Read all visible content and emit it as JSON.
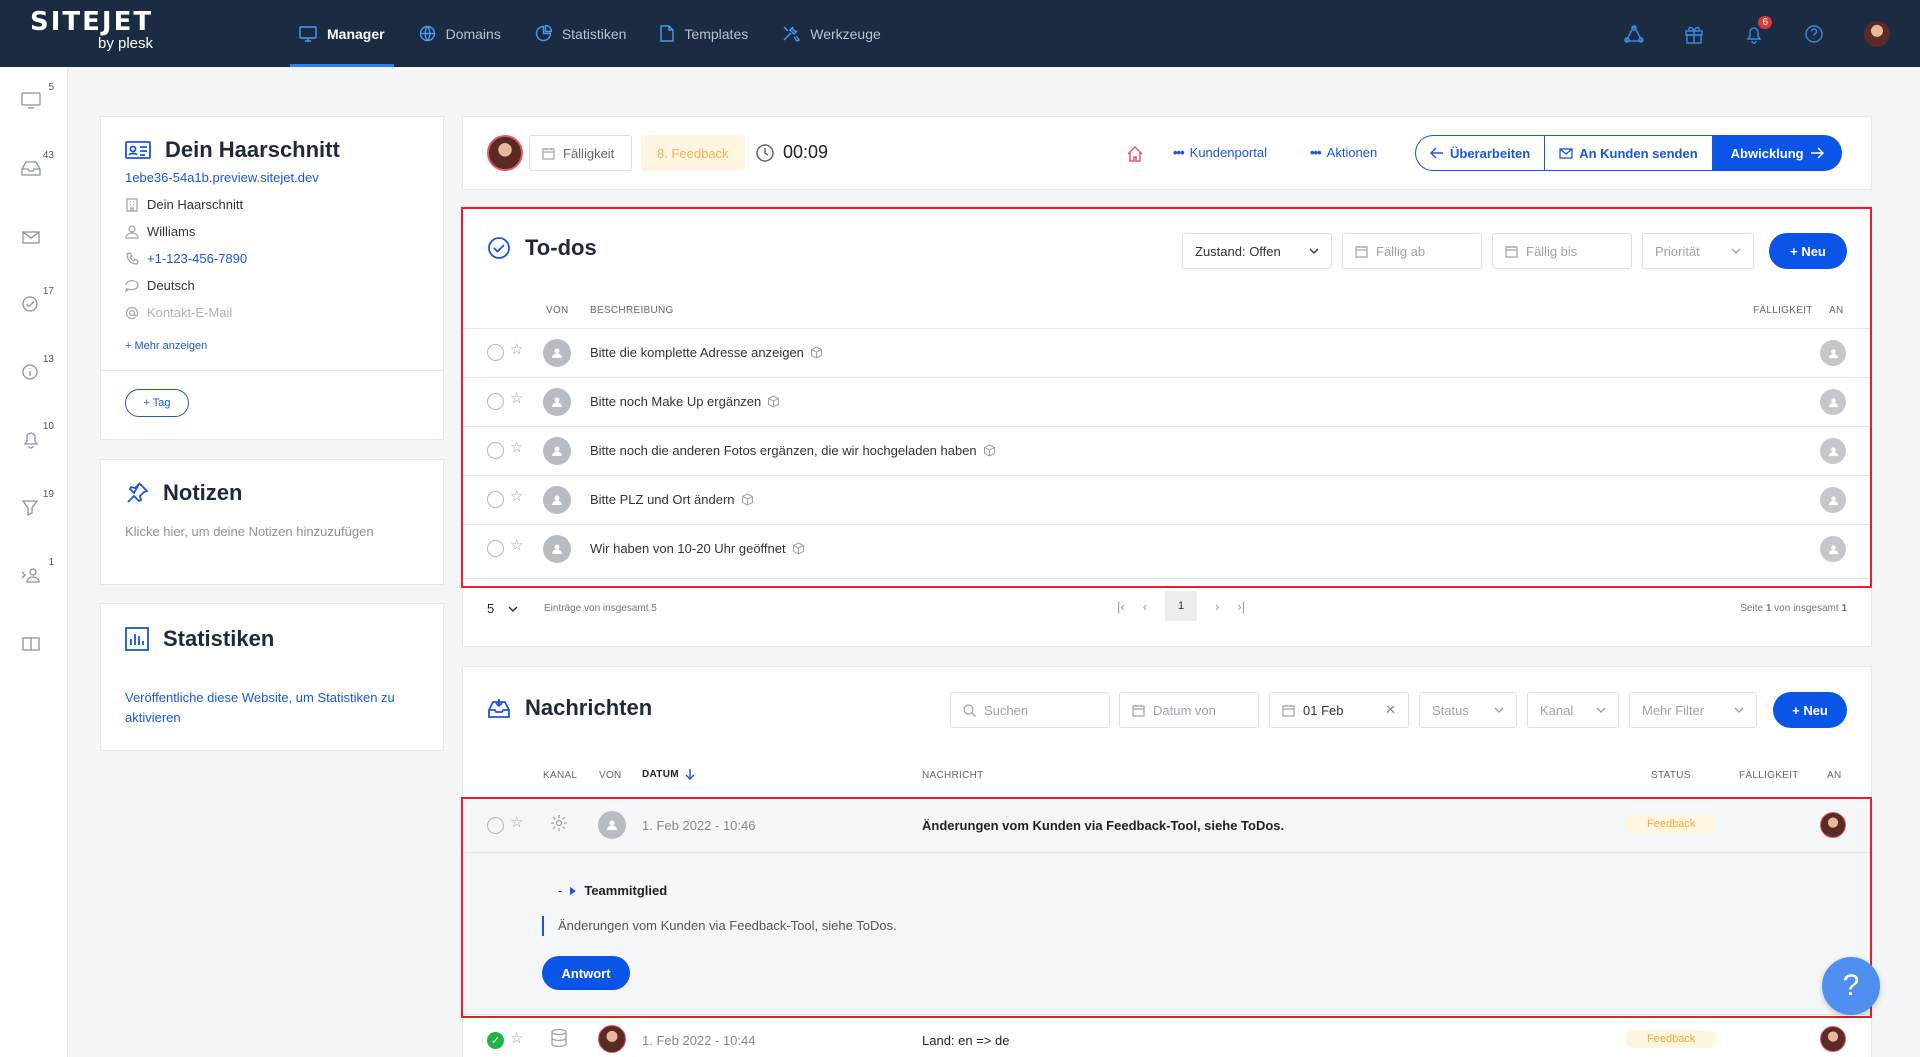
{
  "brand": {
    "name": "SITEJET",
    "sub": "by plesk"
  },
  "nav": [
    {
      "label": "Manager",
      "icon": "monitor-icon",
      "active": true
    },
    {
      "label": "Domains",
      "icon": "globe-icon"
    },
    {
      "label": "Statistiken",
      "icon": "pie-chart-icon"
    },
    {
      "label": "Templates",
      "icon": "file-icon"
    },
    {
      "label": "Werkzeuge",
      "icon": "tools-icon"
    }
  ],
  "top": {
    "notifications": "6"
  },
  "sidebar": {
    "counts": [
      "5",
      "43",
      "17",
      "13",
      "10",
      "19",
      "1"
    ]
  },
  "project": {
    "title": "Dein Haarschnitt",
    "url": "1ebe36-54a1b.preview.sitejet.dev",
    "company": "Dein Haarschnitt",
    "person": "Williams",
    "phone": "+1-123-456-7890",
    "language": "Deutsch",
    "email_placeholder": "Kontakt-E-Mail",
    "more": "+ Mehr anzeigen",
    "tag": "+ Tag"
  },
  "notes": {
    "title": "Notizen",
    "hint": "Klicke hier, um deine Notizen hinzuzufügen"
  },
  "stats": {
    "title": "Statistiken",
    "text": "Veröffentliche diese Website, um Statistiken zu aktivieren"
  },
  "toolbar": {
    "due": "Fälligkeit",
    "phase": "8. Feedback",
    "timer": "00:09",
    "portal": "Kundenportal",
    "actions": "Aktionen",
    "revise": "Überarbeiten",
    "send": "An Kunden senden",
    "process": "Abwicklung"
  },
  "todos": {
    "title": "To-dos",
    "state_filter": "Zustand: Offen",
    "due_from": "Fällig ab",
    "due_to": "Fällig bis",
    "priority": "Priorität",
    "new": "+ Neu",
    "cols": {
      "from": "VON",
      "desc": "BESCHREIBUNG",
      "due": "FÄLLIGKEIT",
      "to": "AN"
    },
    "items": [
      "Bitte die komplette Adresse anzeigen",
      "Bitte noch Make Up ergänzen",
      "Bitte noch die anderen Fotos ergänzen, die wir hochgeladen haben",
      "Bitte PLZ und Ort ändern",
      "Wir haben von 10-20 Uhr geöffnet"
    ],
    "pager": {
      "per_page": "5",
      "total": "Einträge von insgesamt 5",
      "page": "1",
      "summary_pre": "Seite ",
      "summary_num": "1",
      "summary_post": " von insgesamt ",
      "summary_total": "1"
    }
  },
  "messages": {
    "title": "Nachrichten",
    "search": "Suchen",
    "date_from": "Datum von",
    "date_to": "01 Feb",
    "status": "Status",
    "channel": "Kanal",
    "more_filters": "Mehr Filter",
    "new": "+ Neu",
    "cols": {
      "channel": "KANAL",
      "from": "VON",
      "date": "DATUM",
      "msg": "NACHRICHT",
      "status": "STATUS",
      "due": "FÄLLIGKEIT",
      "to": "AN"
    },
    "row1": {
      "date": "1. Feb 2022 - 10:46",
      "text": "Änderungen vom Kunden via Feedback-Tool, siehe ToDos.",
      "status": "Feedback"
    },
    "expanded": {
      "sender_prefix": "-",
      "sender": "Teammitglied",
      "body": "Änderungen vom Kunden via Feedback-Tool, siehe ToDos.",
      "reply": "Antwort"
    },
    "row2": {
      "date": "1. Feb 2022 - 10:44",
      "text": "Land: en => de",
      "status": "Feedback"
    }
  },
  "help": "?"
}
